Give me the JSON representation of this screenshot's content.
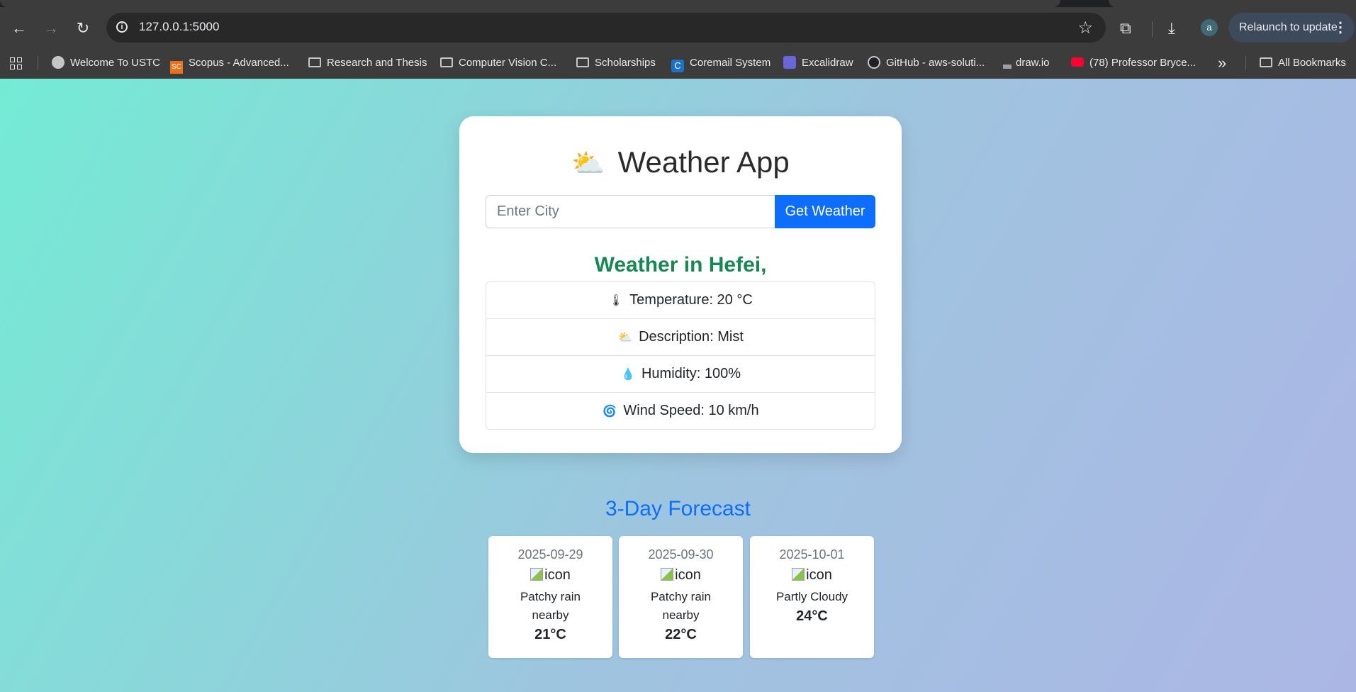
{
  "browser": {
    "url": "127.0.0.1:5000",
    "relaunch_label": "Relaunch to update",
    "profile_initial": "a",
    "bookmarks": [
      {
        "label": "Welcome To USTC",
        "icon": "globe-icon"
      },
      {
        "label": "Scopus - Advanced...",
        "icon": "scopus-icon",
        "badge": "SC"
      },
      {
        "label": "Research and Thesis",
        "icon": "folder-icon"
      },
      {
        "label": "Computer Vision C...",
        "icon": "folder-icon"
      },
      {
        "label": "Scholarships",
        "icon": "folder-icon"
      },
      {
        "label": "Coremail System",
        "icon": "coremail-icon",
        "badge": "C"
      },
      {
        "label": "Excalidraw",
        "icon": "excalidraw-icon"
      },
      {
        "label": "GitHub - aws-soluti...",
        "icon": "github-icon"
      },
      {
        "label": "draw.io",
        "icon": "drawio-icon"
      },
      {
        "label": "(78) Professor Bryce...",
        "icon": "youtube-icon"
      }
    ],
    "overflow_label": "»",
    "all_bookmarks_label": "All Bookmarks"
  },
  "app": {
    "title": "Weather App",
    "title_icon": "sun-behind-cloud-icon",
    "search": {
      "placeholder": "Enter City",
      "value": "",
      "button_label": "Get Weather"
    },
    "heading": "Weather in Hefei,",
    "details": [
      {
        "icon": "thermometer-icon",
        "glyph": "🌡",
        "text": "Temperature: 20 °C"
      },
      {
        "icon": "cloud-icon",
        "glyph": "⛅",
        "text": "Description: Mist"
      },
      {
        "icon": "droplet-icon",
        "glyph": "💧",
        "text": "Humidity: 100%"
      },
      {
        "icon": "wind-icon",
        "glyph": "🌀",
        "text": "Wind Speed: 10 km/h"
      }
    ],
    "forecast_title": "3-Day Forecast",
    "forecast": [
      {
        "date": "2025-09-29",
        "icon_alt": "icon",
        "condition": "Patchy rain nearby",
        "temp": "21°C"
      },
      {
        "date": "2025-09-30",
        "icon_alt": "icon",
        "condition": "Patchy rain nearby",
        "temp": "22°C"
      },
      {
        "date": "2025-10-01",
        "icon_alt": "icon",
        "condition": "Partly Cloudy",
        "temp": "24°C"
      }
    ]
  },
  "colors": {
    "primary": "#0d6efd",
    "success": "#198754",
    "gradient_start": "#74ebd5",
    "gradient_end": "#acb6e5"
  }
}
